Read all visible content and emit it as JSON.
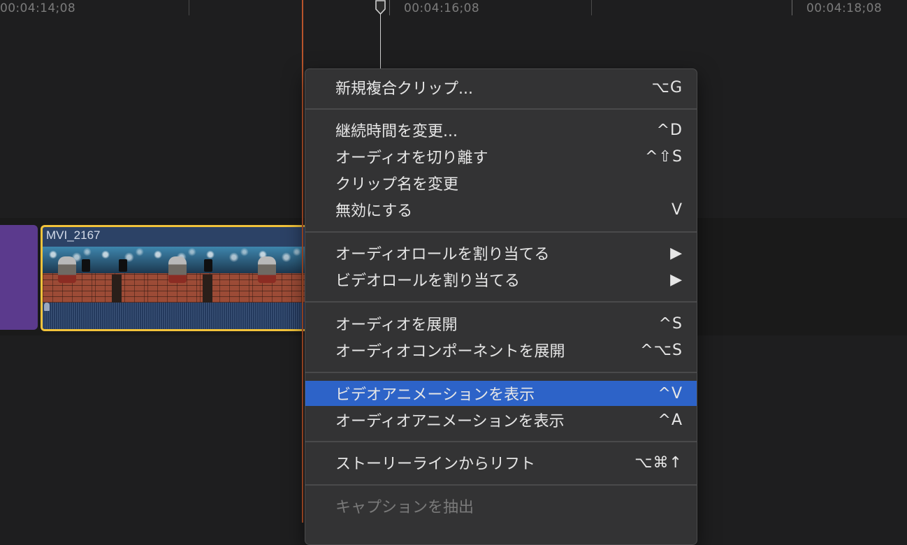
{
  "ruler": {
    "timecodes": [
      "00:04:14;08",
      "00:04:16;08",
      "00:04:18;08"
    ]
  },
  "clip": {
    "title": "MVI_2167"
  },
  "context_menu": {
    "items": [
      {
        "label": "新規複合クリップ...",
        "shortcut": "⌥G"
      },
      {
        "label": "継続時間を変更...",
        "shortcut": "^D"
      },
      {
        "label": "オーディオを切り離す",
        "shortcut": "^⇧S"
      },
      {
        "label": "クリップ名を変更",
        "shortcut": ""
      },
      {
        "label": "無効にする",
        "shortcut": "V"
      },
      {
        "label": "オーディオロールを割り当てる",
        "shortcut": "▶"
      },
      {
        "label": "ビデオロールを割り当てる",
        "shortcut": "▶"
      },
      {
        "label": "オーディオを展開",
        "shortcut": "^S"
      },
      {
        "label": "オーディオコンポーネントを展開",
        "shortcut": "^⌥S"
      },
      {
        "label": "ビデオアニメーションを表示",
        "shortcut": "^V",
        "highlighted": true
      },
      {
        "label": "オーディオアニメーションを表示",
        "shortcut": "^A"
      },
      {
        "label": "ストーリーラインからリフト",
        "shortcut": "⌥⌘↑"
      },
      {
        "label": "キャプションを抽出",
        "shortcut": "",
        "disabled": true
      }
    ]
  },
  "colors": {
    "highlight": "#2d63c8",
    "clip_border": "#f2c33b",
    "playhead": "#b8542b",
    "compound_clip": "#5b3a8d"
  }
}
